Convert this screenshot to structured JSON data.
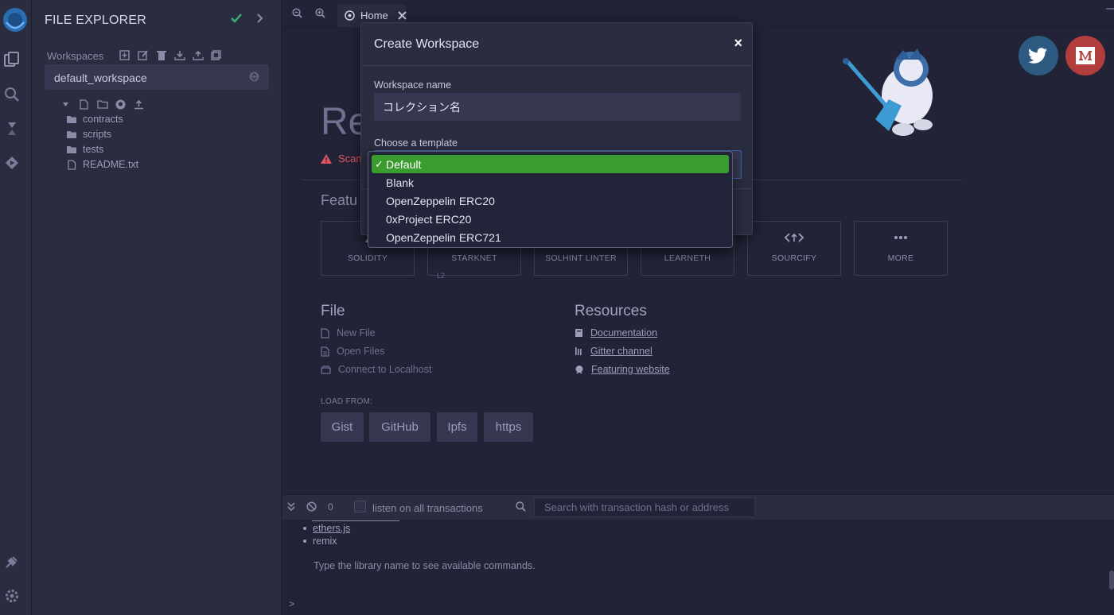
{
  "explorer": {
    "title": "FILE EXPLORER",
    "workspaces_label": "Workspaces",
    "current_workspace": "default_workspace",
    "tree": [
      {
        "name": "contracts",
        "kind": "folder"
      },
      {
        "name": "scripts",
        "kind": "folder"
      },
      {
        "name": "tests",
        "kind": "folder"
      },
      {
        "name": "README.txt",
        "kind": "file"
      }
    ]
  },
  "tabs": {
    "home_label": "Home"
  },
  "home": {
    "title_partial": "Re",
    "scam_partial": "Scam",
    "featured_partial": "Featu",
    "featured": [
      {
        "label": "SOLIDITY",
        "icon": "solidity-icon"
      },
      {
        "label": "STARKNET",
        "icon": "starknet-icon"
      },
      {
        "label": "SOLHINT LINTER",
        "icon": "solhint-icon"
      },
      {
        "label": "LEARNETH",
        "icon": "learneth-icon"
      },
      {
        "label": "SOURCIFY",
        "icon": "sourcify-icon"
      },
      {
        "label": "MORE",
        "icon": "more-icon"
      }
    ],
    "l2_tag": "L2",
    "file_heading": "File",
    "file_links": [
      "New File",
      "Open Files",
      "Connect to Localhost"
    ],
    "resources_heading": "Resources",
    "resource_links": [
      "Documentation",
      "Gitter channel",
      "Featuring website"
    ],
    "load_from": "LOAD FROM:",
    "load_buttons": [
      "Gist",
      "GitHub",
      "Ipfs",
      "https"
    ]
  },
  "terminal": {
    "count": "0",
    "listen_label": "listen on all transactions",
    "search_placeholder": "Search with transaction hash or address",
    "libs": [
      "ethers.js",
      "remix"
    ],
    "message": "Type the library name to see available commands.",
    "prompt": ">"
  },
  "modal": {
    "title": "Create Workspace",
    "close": "×",
    "name_label": "Workspace name",
    "name_value": "コレクション名",
    "template_label": "Choose a template",
    "templates": [
      "Default",
      "Blank",
      "OpenZeppelin ERC20",
      "0xProject ERC20",
      "OpenZeppelin ERC721"
    ],
    "selected_template": "Default",
    "check_mark": "✓"
  },
  "colors": {
    "selected_option": "#3a9b2e",
    "twitter": "#2c5a80",
    "medium": "#b13d3d",
    "status_ok": "#3cb371",
    "warning": "#e05561"
  }
}
